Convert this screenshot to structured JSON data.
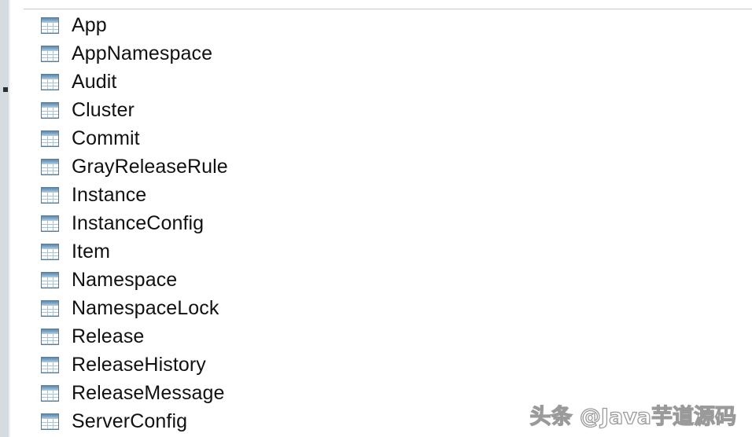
{
  "window": {
    "background_color": "#ffffff",
    "gutter_color": "#d5dce1",
    "divider_color": "#c8c8c8"
  },
  "gutter": {
    "marker_name": "breakpoint-marker"
  },
  "table_list": {
    "icon_name": "database-table-icon",
    "icon_header_color": "#5d89ab",
    "icon_grid_color": "#a9c4d8",
    "items": [
      {
        "label": "App"
      },
      {
        "label": "AppNamespace"
      },
      {
        "label": "Audit"
      },
      {
        "label": "Cluster"
      },
      {
        "label": "Commit"
      },
      {
        "label": "GrayReleaseRule"
      },
      {
        "label": "Instance"
      },
      {
        "label": "InstanceConfig"
      },
      {
        "label": "Item"
      },
      {
        "label": "Namespace"
      },
      {
        "label": "NamespaceLock"
      },
      {
        "label": "Release"
      },
      {
        "label": "ReleaseHistory"
      },
      {
        "label": "ReleaseMessage"
      },
      {
        "label": "ServerConfig"
      }
    ]
  },
  "watermark": {
    "text": "头条 @Java芋道源码"
  }
}
